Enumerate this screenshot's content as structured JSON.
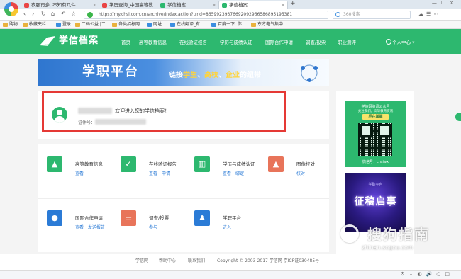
{
  "browser": {
    "tabs": [
      {
        "label": "衣服再多, 不知有几件",
        "favicon_color": "#e94545"
      },
      {
        "label": "学历查询_中国高等教",
        "favicon_color": "#e94545"
      },
      {
        "label": "学信档案",
        "favicon_color": "#2db86f"
      },
      {
        "label": "学信档案",
        "favicon_color": "#2db86f",
        "active": true
      }
    ],
    "url": "https://my.chsi.com.cn/archive/index.action?trnd=86599239376692092966586895195381",
    "search_placeholder": "360搜索",
    "bookmarks": [
      "购物",
      "收藏夹栏",
      "登录",
      "二码公益 |二",
      "各类招标网",
      "网址",
      "在线翻译_有",
      "百度一下, 你",
      "东方电气集中"
    ]
  },
  "site": {
    "title": "学信档案",
    "nav": [
      "首页",
      "高等教育信息",
      "在线验证报告",
      "学历与成绩认证",
      "国际合作申请",
      "调查/投票",
      "职业测评"
    ],
    "user_menu": "个人中心"
  },
  "banner": {
    "title": "学职平台",
    "slogan_prefix": "链接",
    "slogan_1": "学生",
    "slogan_sep1": "、",
    "slogan_2": "高校",
    "slogan_sep2": "、",
    "slogan_3": "企业",
    "slogan_suffix": "的纽带"
  },
  "welcome": {
    "text": "欢迎进入您的学信档案！",
    "id_label": "证件号："
  },
  "sidebar": {
    "qr_heading": "学信网资讯公众号",
    "qr_sub": "关注我们，高等教育资讯",
    "qr_badge": "尽在掌握",
    "qr_id": "微信号：chsiwx",
    "promo_top": "学职平台",
    "promo_text": "征稿启事"
  },
  "services": [
    {
      "title": "高等教育信息",
      "links": [
        "查看"
      ],
      "color": "#2db86f",
      "icon": "graduation-cap-icon",
      "glyph": "▲"
    },
    {
      "title": "在线验证报告",
      "links": [
        "查看",
        "申请"
      ],
      "color": "#2db86f",
      "icon": "shield-check-icon",
      "glyph": "✓"
    },
    {
      "title": "学历与成绩认证",
      "links": [
        "查看",
        "绑定"
      ],
      "color": "#2db86f",
      "icon": "open-book-icon",
      "glyph": "▥"
    },
    {
      "title": "图像校对",
      "links": [
        "校对"
      ],
      "color": "#e8745a",
      "icon": "image-icon",
      "glyph": "▲"
    },
    {
      "title": "国际合作申请",
      "links": [
        "查看",
        "发送报告"
      ],
      "color": "#2b7bd6",
      "icon": "globe-icon",
      "glyph": "●"
    },
    {
      "title": "调查/投票",
      "links": [
        "参与"
      ],
      "color": "#e8745a",
      "icon": "list-form-icon",
      "glyph": "☰"
    },
    {
      "title": "学职平台",
      "links": [
        "进入"
      ],
      "color": "#2b7bd6",
      "icon": "person-tie-icon",
      "glyph": "♟"
    }
  ],
  "footer": {
    "links": [
      "学信网",
      "帮助中心",
      "联系我们"
    ],
    "copyright": "Copyright © 2003-2017 学信网 京ICP证030485号"
  },
  "watermark": {
    "text": "搜狗指南",
    "sub": "zhinan.sogou.com"
  },
  "colors": {
    "brand_green": "#2db86f",
    "highlight_red": "#e53935",
    "link_blue": "#2b7bd6"
  }
}
